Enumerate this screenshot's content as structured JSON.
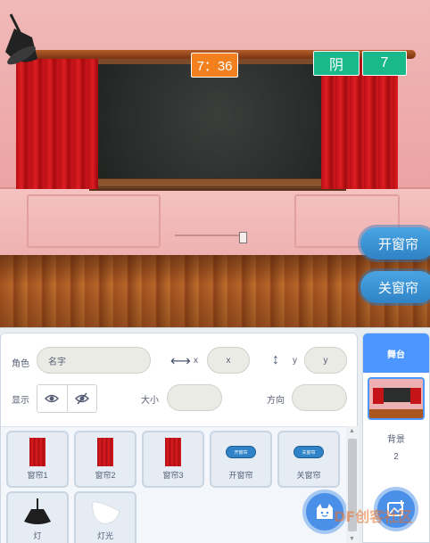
{
  "stage": {
    "time": "7：36",
    "weather": "阴",
    "temperature": "7",
    "buttons": {
      "open": "开窗帘",
      "close": "关窗帘"
    }
  },
  "sprite_info": {
    "sprite_label": "角色",
    "name_placeholder": "名字",
    "x_placeholder": "x",
    "y_placeholder": "y",
    "show_label": "显示",
    "size_label": "大小",
    "direction_label": "方向",
    "x_axis": "x",
    "y_axis": "y"
  },
  "sprites": [
    {
      "name": "窗帘1",
      "icon": "curtain"
    },
    {
      "name": "窗帘2",
      "icon": "curtain"
    },
    {
      "name": "窗帘3",
      "icon": "curtain"
    },
    {
      "name": "开窗帘",
      "icon": "button",
      "thumb_text": "开窗帘"
    },
    {
      "name": "关窗帘",
      "icon": "button",
      "thumb_text": "关窗帘"
    },
    {
      "name": "灯",
      "icon": "lamp"
    },
    {
      "name": "灯光",
      "icon": "light"
    }
  ],
  "stage_panel": {
    "title": "舞台",
    "backdrop_label": "背景",
    "backdrop_count": "2"
  },
  "watermark": "DF创客社区",
  "colors": {
    "accent": "#4c97ff",
    "time_badge": "#f2801f",
    "weather_badge": "#1ab98c",
    "stage_button": "#2f83c6"
  }
}
